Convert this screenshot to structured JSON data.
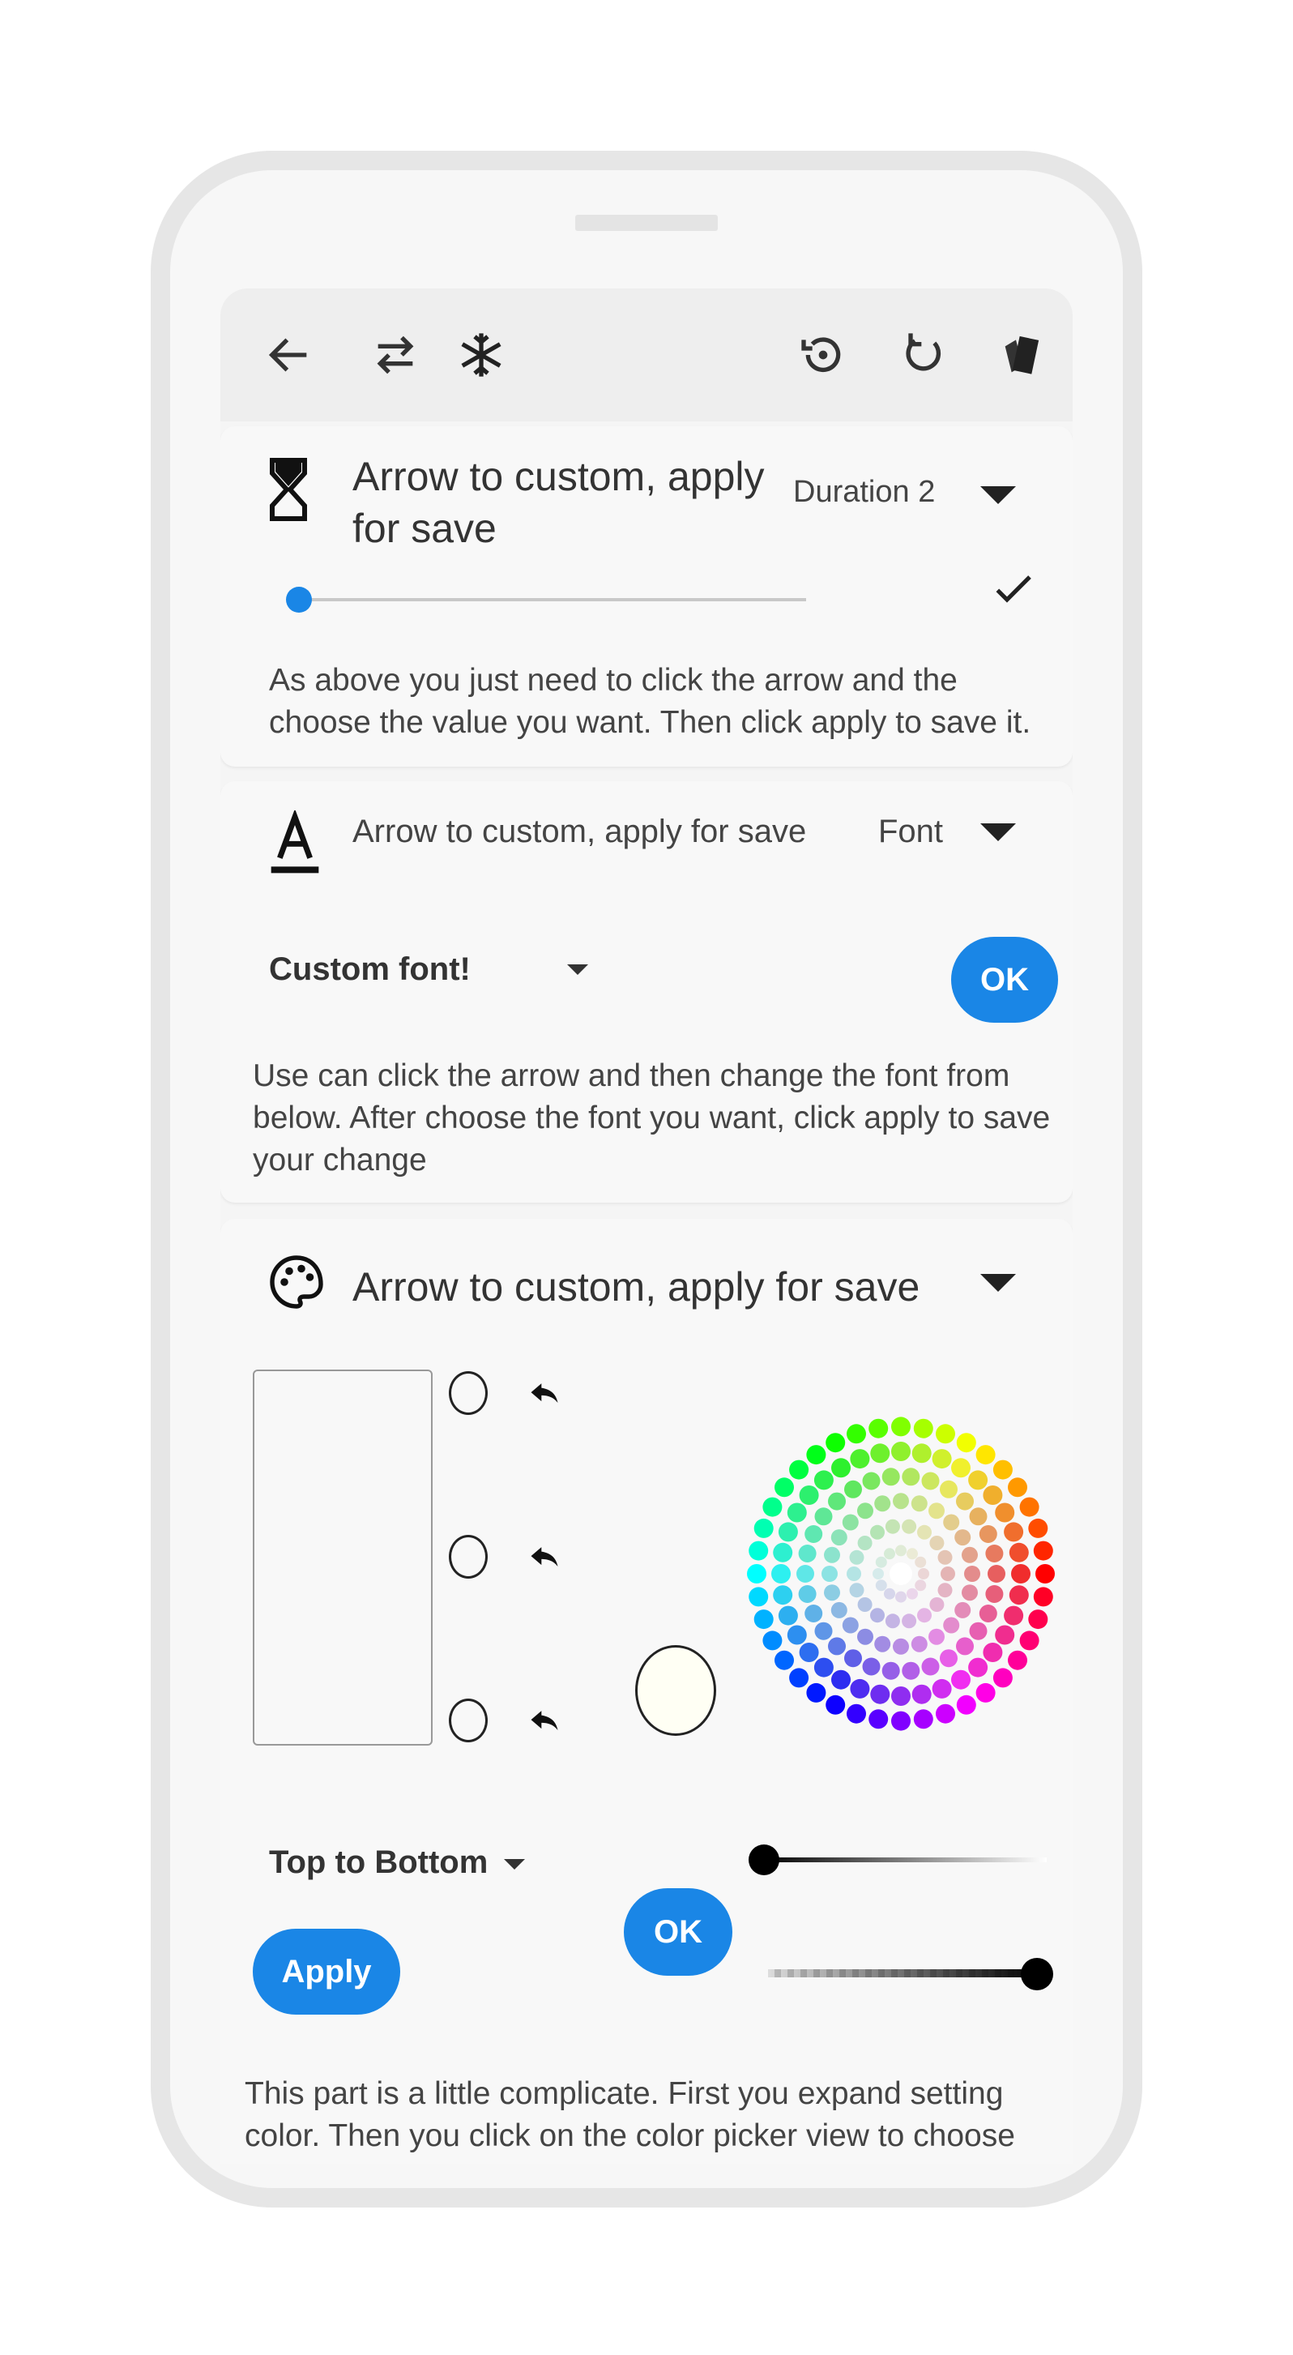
{
  "toolbar": {
    "icons": [
      "back-arrow-icon",
      "swap-icon",
      "snowflake-icon",
      "restore-icon",
      "refresh-icon",
      "cards-icon"
    ]
  },
  "duration_card": {
    "title": "Arrow to custom, apply for save",
    "selected": "Duration 2",
    "slider_value": 0,
    "description": "As above you just need to click the arrow and the choose the value you want. Then click apply to save it."
  },
  "font_card": {
    "title": "Arrow to custom, apply for save",
    "selected": "Font",
    "font_select": "Custom font!",
    "ok_label": "OK",
    "description": "Use can click the arrow and then change the font from below. After choose the font you want, click apply to save your change"
  },
  "color_card": {
    "title": "Arrow to custom, apply for save",
    "direction_select": "Top to Bottom",
    "apply_label": "Apply",
    "ok_label": "OK",
    "swatch_color": "#fffff4",
    "lightness_slider": 0,
    "alpha_slider": 1,
    "description": "This part is a little complicate. First you expand setting color. Then you click on the color picker view to choose"
  },
  "colors": {
    "accent": "#1a86e6"
  }
}
